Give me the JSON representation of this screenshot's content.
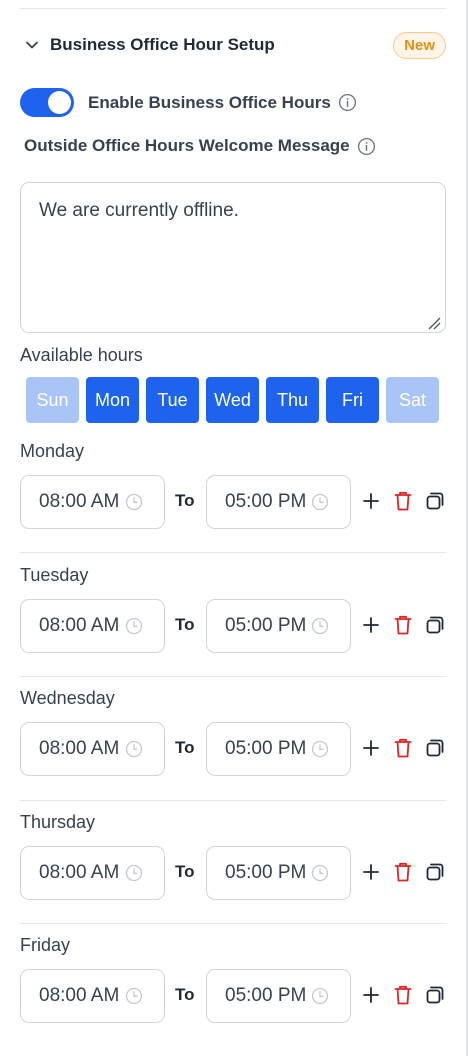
{
  "section": {
    "title": "Business Office Hour Setup",
    "badge": "New"
  },
  "toggle": {
    "label": "Enable Business Office Hours",
    "enabled": true
  },
  "welcome_message": {
    "label": "Outside Office Hours Welcome Message",
    "value": "We are currently offline."
  },
  "available_hours": {
    "label": "Available hours",
    "days": [
      {
        "label": "Sun",
        "selected": false
      },
      {
        "label": "Mon",
        "selected": true
      },
      {
        "label": "Tue",
        "selected": true
      },
      {
        "label": "Wed",
        "selected": true
      },
      {
        "label": "Thu",
        "selected": true
      },
      {
        "label": "Fri",
        "selected": true
      },
      {
        "label": "Sat",
        "selected": false
      }
    ]
  },
  "to_label": "To",
  "schedule": [
    {
      "day": "Monday",
      "from": "08:00 AM",
      "to": "05:00 PM"
    },
    {
      "day": "Tuesday",
      "from": "08:00 AM",
      "to": "05:00 PM"
    },
    {
      "day": "Wednesday",
      "from": "08:00 AM",
      "to": "05:00 PM"
    },
    {
      "day": "Thursday",
      "from": "08:00 AM",
      "to": "05:00 PM"
    },
    {
      "day": "Friday",
      "from": "08:00 AM",
      "to": "05:00 PM"
    }
  ],
  "colors": {
    "primary": "#1d63ed",
    "primary_light": "#a9c4f7",
    "danger": "#dc2626",
    "badge_bg": "#fff4e5",
    "badge_text": "#e69019"
  },
  "icons": {
    "collapse": "chevron-down-icon",
    "info": "info-icon",
    "clock": "clock-icon",
    "add": "plus-icon",
    "delete": "trash-icon",
    "copy": "copy-icon"
  }
}
